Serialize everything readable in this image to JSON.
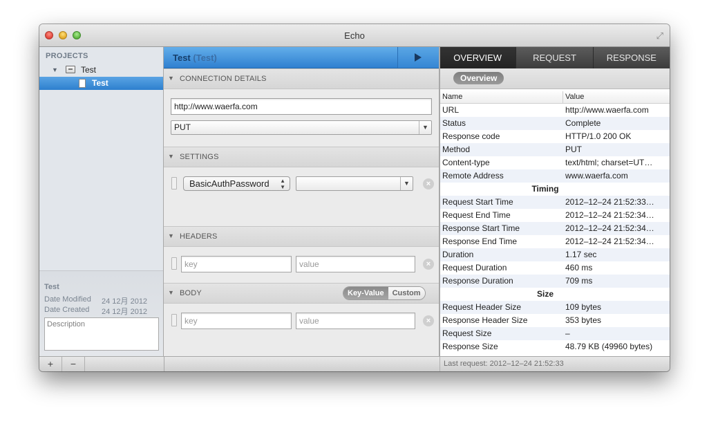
{
  "window": {
    "title": "Echo"
  },
  "sidebar": {
    "header": "PROJECTS",
    "project": {
      "label": "Test"
    },
    "request": {
      "label": "Test"
    },
    "info": {
      "title": "Test",
      "date_modified_label": "Date Modified",
      "date_modified_value": "24 12月 2012",
      "date_created_label": "Date Created",
      "date_created_value": "24 12月 2012",
      "description_placeholder": "Description"
    }
  },
  "bottombar": {
    "add_label": "+",
    "remove_label": "−",
    "status": "Last request: 2012–12–24 21:52:33"
  },
  "editor": {
    "request_name": "Test",
    "request_project": "(Test)",
    "connection": {
      "title": "CONNECTION DETAILS",
      "url": "http://www.waerfa.com",
      "method": "PUT"
    },
    "settings": {
      "title": "SETTINGS",
      "setting_name": "BasicAuthPassword",
      "setting_value": ""
    },
    "headers": {
      "title": "HEADERS",
      "key_placeholder": "key",
      "value_placeholder": "value"
    },
    "body": {
      "title": "BODY",
      "mode_keyvalue": "Key-Value",
      "mode_custom": "Custom",
      "key_placeholder": "key",
      "value_placeholder": "value"
    }
  },
  "results": {
    "tabs": [
      "OVERVIEW",
      "REQUEST",
      "RESPONSE"
    ],
    "subtab": "Overview",
    "columns": {
      "name": "Name",
      "value": "Value"
    },
    "rows": [
      {
        "name": "URL",
        "value": "http://www.waerfa.com"
      },
      {
        "name": "Status",
        "value": "Complete"
      },
      {
        "name": "Response code",
        "value": "HTTP/1.0 200 OK"
      },
      {
        "name": "Method",
        "value": "PUT"
      },
      {
        "name": "Content-type",
        "value": "text/html; charset=UT…"
      },
      {
        "name": "Remote Address",
        "value": "www.waerfa.com"
      },
      {
        "group": "Timing"
      },
      {
        "name": "Request Start Time",
        "value": "2012–12–24 21:52:33…"
      },
      {
        "name": "Request End Time",
        "value": "2012–12–24 21:52:34…"
      },
      {
        "name": "Response Start Time",
        "value": "2012–12–24 21:52:34…"
      },
      {
        "name": "Response End Time",
        "value": "2012–12–24 21:52:34…"
      },
      {
        "name": "Duration",
        "value": "1.17 sec"
      },
      {
        "name": "Request Duration",
        "value": "460 ms"
      },
      {
        "name": "Response Duration",
        "value": "709 ms"
      },
      {
        "group": "Size"
      },
      {
        "name": "Request Header Size",
        "value": "109 bytes"
      },
      {
        "name": "Response Header Size",
        "value": "353 bytes"
      },
      {
        "name": "Request Size",
        "value": "–"
      },
      {
        "name": "Response Size",
        "value": "48.79 KB (49960 bytes)"
      }
    ]
  }
}
